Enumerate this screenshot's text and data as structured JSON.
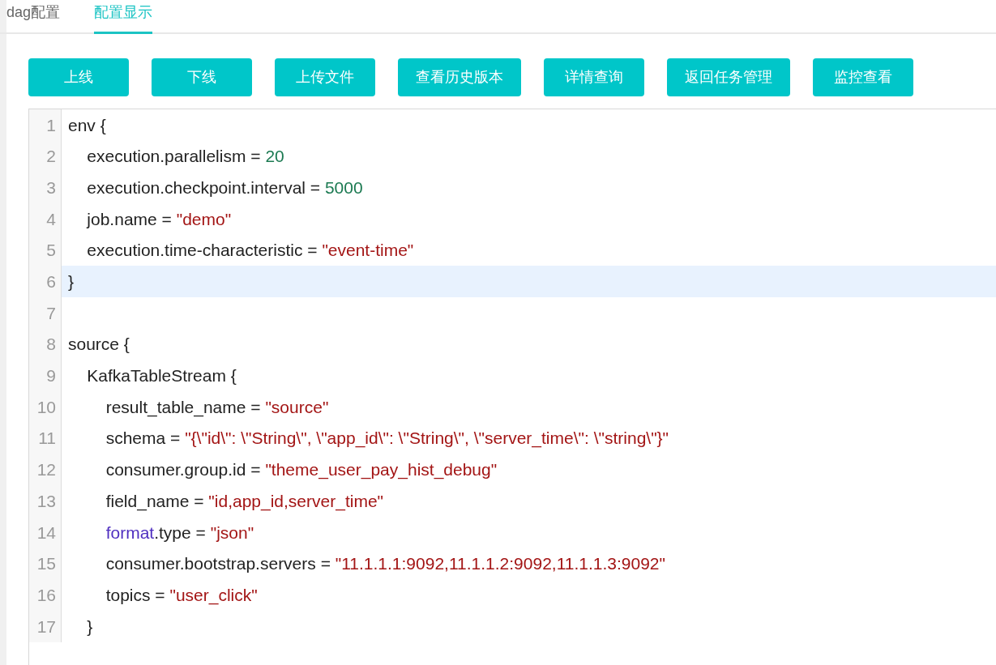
{
  "tabs": [
    {
      "label": "dag配置",
      "selected": false
    },
    {
      "label": "配置显示",
      "selected": true
    }
  ],
  "buttons": [
    "上线",
    "下线",
    "上传文件",
    "查看历史版本",
    "详情查询",
    "返回任务管理",
    "监控查看"
  ],
  "editor": {
    "lines": [
      {
        "number": "1",
        "highlighted": false,
        "segments": [
          {
            "kind": "plain",
            "text": "env {"
          }
        ]
      },
      {
        "number": "2",
        "highlighted": false,
        "segments": [
          {
            "kind": "plain",
            "text": "    execution.parallelism = "
          },
          {
            "kind": "number",
            "text": "20"
          }
        ]
      },
      {
        "number": "3",
        "highlighted": false,
        "segments": [
          {
            "kind": "plain",
            "text": "    execution.checkpoint.interval = "
          },
          {
            "kind": "number",
            "text": "5000"
          }
        ]
      },
      {
        "number": "4",
        "highlighted": false,
        "segments": [
          {
            "kind": "plain",
            "text": "    job.name = "
          },
          {
            "kind": "string",
            "text": "\"demo\""
          }
        ]
      },
      {
        "number": "5",
        "highlighted": false,
        "segments": [
          {
            "kind": "plain",
            "text": "    execution.time-characteristic = "
          },
          {
            "kind": "string",
            "text": "\"event-time\""
          }
        ]
      },
      {
        "number": "6",
        "highlighted": true,
        "segments": [
          {
            "kind": "plain",
            "text": "}"
          }
        ]
      },
      {
        "number": "7",
        "highlighted": false
      },
      {
        "number": "8",
        "highlighted": false,
        "segments": [
          {
            "kind": "plain",
            "text": "source {"
          }
        ]
      },
      {
        "number": "9",
        "highlighted": false,
        "segments": [
          {
            "kind": "plain",
            "text": "    KafkaTableStream {"
          }
        ]
      },
      {
        "number": "10",
        "highlighted": false,
        "segments": [
          {
            "kind": "plain",
            "text": "        result_table_name = "
          },
          {
            "kind": "string",
            "text": "\"source\""
          }
        ]
      },
      {
        "number": "11",
        "highlighted": false,
        "segments": [
          {
            "kind": "plain",
            "text": "        schema = "
          },
          {
            "kind": "string",
            "text": "\"{\\\"id\\\": \\\"String\\\", \\\"app_id\\\": \\\"String\\\", \\\"server_time\\\": \\\"string\\\"}\""
          }
        ]
      },
      {
        "number": "12",
        "highlighted": false,
        "segments": [
          {
            "kind": "plain",
            "text": "        consumer.group.id = "
          },
          {
            "kind": "string",
            "text": "\"theme_user_pay_hist_debug\""
          }
        ]
      },
      {
        "number": "13",
        "highlighted": false,
        "segments": [
          {
            "kind": "plain",
            "text": "        field_name = "
          },
          {
            "kind": "string",
            "text": "\"id,app_id,server_time\""
          }
        ]
      },
      {
        "number": "14",
        "highlighted": false,
        "segments": [
          {
            "kind": "keyword",
            "text": "        format"
          },
          {
            "kind": "plain",
            "text": ".type = "
          },
          {
            "kind": "string",
            "text": "\"json\""
          }
        ]
      },
      {
        "number": "15",
        "highlighted": false,
        "segments": [
          {
            "kind": "plain",
            "text": "        consumer.bootstrap.servers = "
          },
          {
            "kind": "string",
            "text": "\"11.1.1.1:9092,11.1.1.2:9092,11.1.1.3:9092\""
          }
        ]
      },
      {
        "number": "16",
        "highlighted": false,
        "segments": [
          {
            "kind": "plain",
            "text": "        topics = "
          },
          {
            "kind": "string",
            "text": "\"user_click\""
          }
        ]
      },
      {
        "number": "17",
        "highlighted": false,
        "segments": [
          {
            "kind": "plain",
            "text": "    }"
          }
        ]
      }
    ]
  }
}
